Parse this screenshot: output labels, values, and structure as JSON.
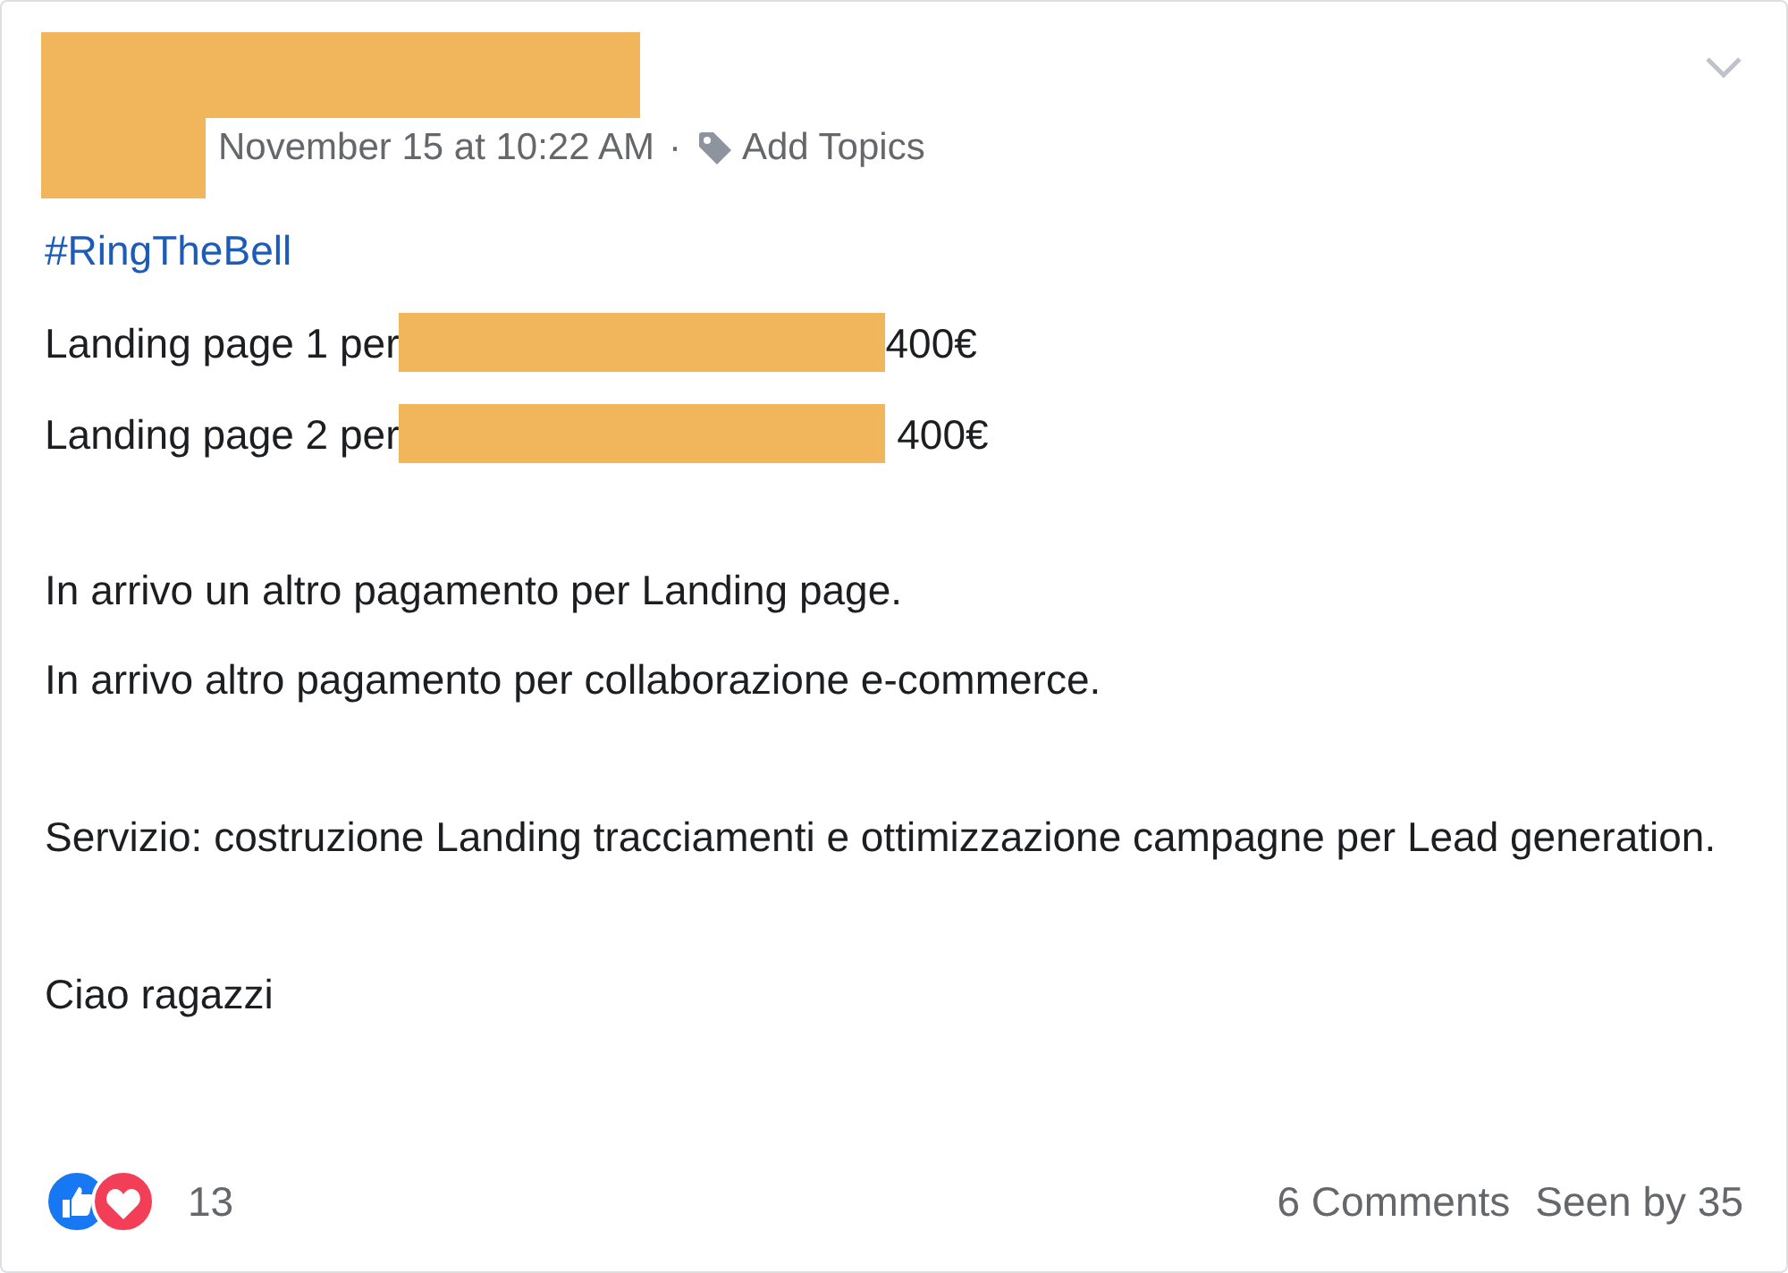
{
  "post": {
    "date": "November 15 at 10:22 AM",
    "separator": "·",
    "topics": "Add Topics",
    "hashtag": "#RingTheBell",
    "lines": [
      {
        "kind": "price",
        "label": "Landing page 1 per",
        "amount": "400€"
      },
      {
        "kind": "price",
        "label": "Landing page 2 per",
        "amount": " 400€"
      },
      {
        "kind": "spacer"
      },
      {
        "kind": "text",
        "text": "In arrivo un altro pagamento per Landing page."
      },
      {
        "kind": "text",
        "text": "In arrivo altro pagamento per collaborazione e-commerce."
      },
      {
        "kind": "spacer"
      },
      {
        "kind": "text",
        "text": "Servizio: costruzione Landing tracciamenti e ottimizzazione campagne per Lead generation."
      },
      {
        "kind": "spacer"
      },
      {
        "kind": "text",
        "text": "Ciao ragazzi"
      }
    ],
    "reactions": {
      "count": "13"
    },
    "comments": "6 Comments",
    "seen": "Seen by 35"
  }
}
